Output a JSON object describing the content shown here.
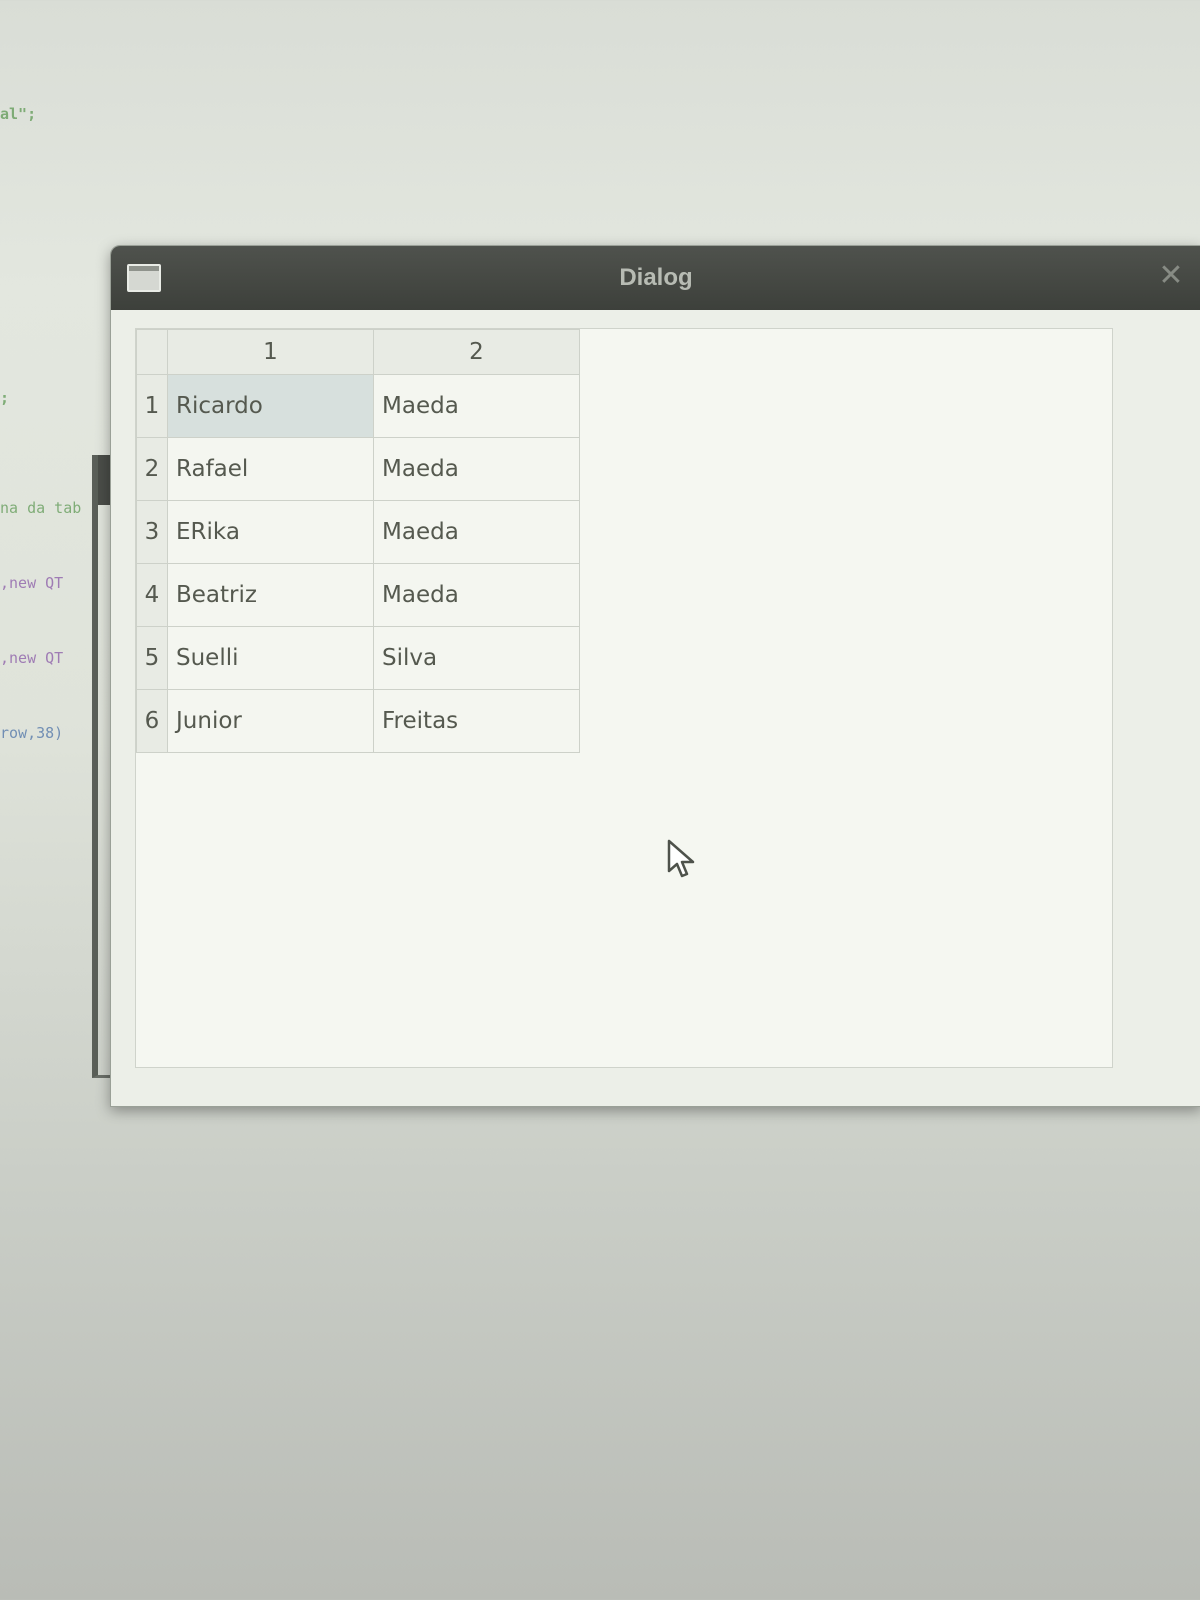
{
  "background_code": {
    "line_top": "al\";",
    "line_mid": ";",
    "block_lines": [
      {
        "text": "na da tab",
        "color": "#5f9a55"
      },
      {
        "text": ",new QT",
        "color": "#8a5aa8"
      },
      {
        "text": ",new QT",
        "color": "#8a5aa8"
      },
      {
        "text": "row,38)",
        "color": "#4d73a8"
      }
    ]
  },
  "dialog": {
    "title": "Dialog",
    "close_glyph": "✕",
    "table": {
      "columns": [
        "1",
        "2"
      ],
      "rows": [
        {
          "header": "1",
          "cells": [
            "Ricardo",
            "Maeda"
          ],
          "selected_col": 0
        },
        {
          "header": "2",
          "cells": [
            "Rafael",
            "Maeda"
          ]
        },
        {
          "header": "3",
          "cells": [
            "ERika",
            "Maeda"
          ]
        },
        {
          "header": "4",
          "cells": [
            "Beatriz",
            "Maeda"
          ]
        },
        {
          "header": "5",
          "cells": [
            "Suelli",
            "Silva"
          ]
        },
        {
          "header": "6",
          "cells": [
            "Junior",
            "Freitas"
          ]
        }
      ]
    }
  }
}
